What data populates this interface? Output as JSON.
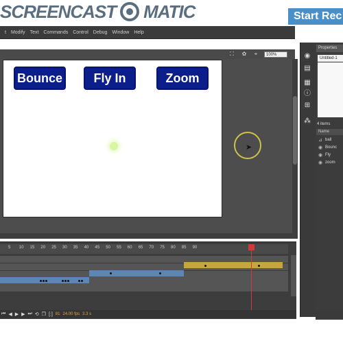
{
  "watermark": {
    "left": "SCREENCAST",
    "right": "MATIC",
    "start_record": "Start Rec"
  },
  "menu": {
    "items": [
      "t",
      "Modify",
      "Text",
      "Commands",
      "Control",
      "Debug",
      "Window",
      "Help"
    ]
  },
  "toolbar": {
    "zoom": "100%"
  },
  "stage": {
    "buttons": [
      {
        "label": "Bounce"
      },
      {
        "label": "Fly In"
      },
      {
        "label": "Zoom"
      }
    ]
  },
  "properties": {
    "tab": "Properties",
    "doc_name": "Untitled-1"
  },
  "library": {
    "count": "4 items",
    "header": "Name",
    "items": [
      "ball",
      "Bounc",
      "Fly",
      "zoom"
    ]
  },
  "timeline": {
    "ruler": [
      "5",
      "10",
      "15",
      "20",
      "25",
      "30",
      "35",
      "40",
      "45",
      "50",
      "55",
      "60",
      "65",
      "70",
      "75",
      "80",
      "85",
      "90"
    ],
    "current_frame": "81",
    "fps": "24.00 fps",
    "time": "3.3 s"
  },
  "colors": {
    "stage_button_bg": "#0b1e8a",
    "tween_gold": "#c9a63c",
    "tween_blue": "#5b86b6",
    "playhead": "#d23a3a"
  }
}
